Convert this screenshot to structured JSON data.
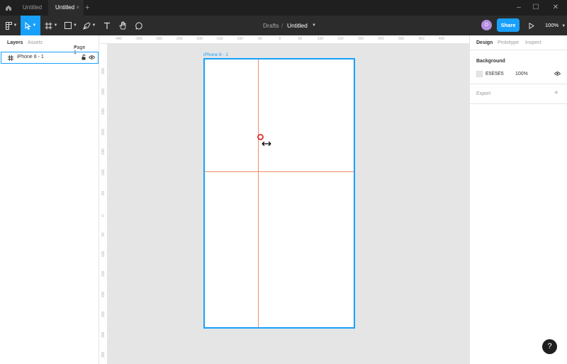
{
  "titlebar": {
    "tabs": [
      {
        "label": "Untitled",
        "active": false
      },
      {
        "label": "Untitled",
        "active": true
      }
    ],
    "new_tab": "+",
    "close_tab": "×"
  },
  "toolbar": {
    "breadcrumb_parent": "Drafts",
    "breadcrumb_sep": "/",
    "file_name": "Untitled",
    "avatar_initial": "D",
    "share_label": "Share",
    "zoom_label": "100%"
  },
  "left_panel": {
    "tab_layers": "Layers",
    "tab_assets": "Assets",
    "page_selector": "Page 1",
    "layers": [
      {
        "name": "iPhone 8 - 1",
        "icon": "frame-icon"
      }
    ]
  },
  "rulers": {
    "top": [
      "-400",
      "-350",
      "-300",
      "-250",
      "-200",
      "-150",
      "-100",
      "-50",
      "0",
      "50",
      "100",
      "150",
      "200",
      "250",
      "300",
      "350",
      "400"
    ],
    "left": [
      "-350",
      "-300",
      "-250",
      "-200",
      "-150",
      "-100",
      "-50",
      "0",
      "50",
      "100",
      "150",
      "200",
      "250",
      "300",
      "350",
      "400"
    ]
  },
  "canvas": {
    "frame_label": "iPhone 8 - 1"
  },
  "right_panel": {
    "tab_design": "Design",
    "tab_prototype": "Prototype",
    "tab_inspect": "Inspect",
    "background_title": "Background",
    "bg_hex": "E5E5E5",
    "bg_opacity": "100%",
    "export_title": "Export",
    "export_add": "+"
  },
  "help_label": "?",
  "colors": {
    "accent": "#18a0fb",
    "guide": "#f08c6c",
    "toolbar_bg": "#2c2c2c",
    "canvas_bg": "#e5e5e5"
  }
}
